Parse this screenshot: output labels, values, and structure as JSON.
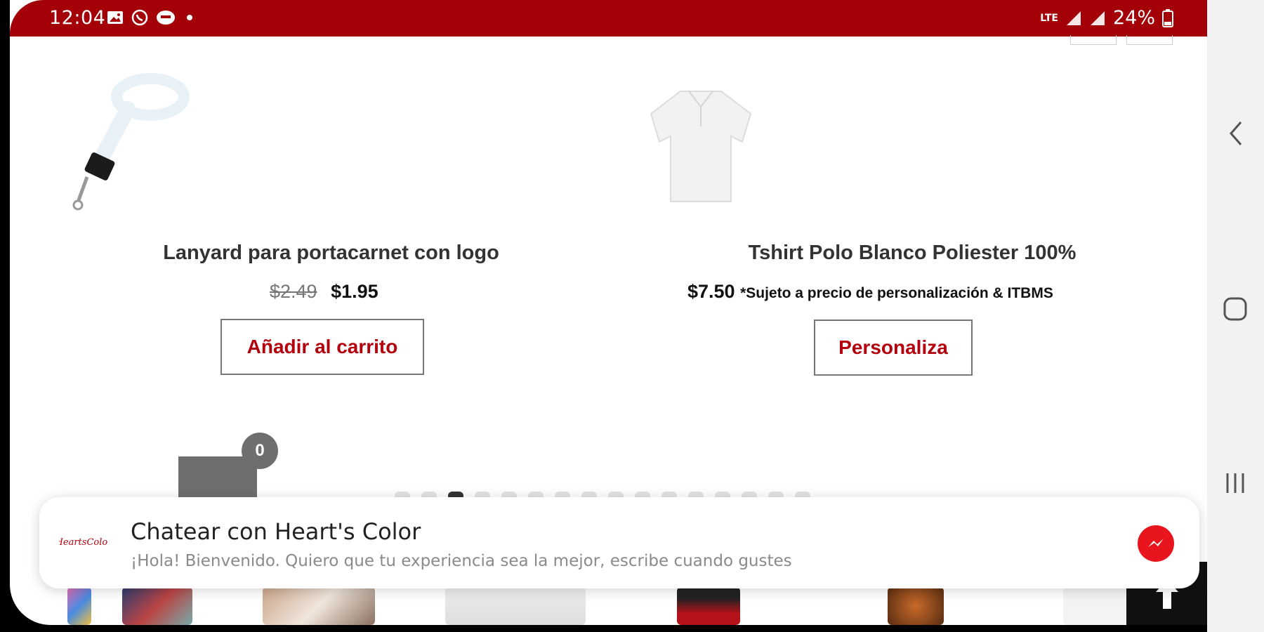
{
  "status_bar": {
    "time": "12:04",
    "battery": "24%",
    "network": "LTE",
    "icons": [
      "gallery-icon",
      "whatsapp-icon",
      "messaging-icon",
      "dot-icon",
      "signal-icon",
      "signal-icon",
      "battery-icon"
    ],
    "bg_color": "#a30008"
  },
  "products": [
    {
      "title": "Lanyard para portacarnet con logo",
      "old_price": "$2.49",
      "price": "$1.95",
      "note": "",
      "button": "Añadir al carrito"
    },
    {
      "title": "Tshirt Polo Blanco Poliester 100%",
      "old_price": "",
      "price": "$7.50",
      "note": "*Sujeto a precio de personalización & ITBMS",
      "button": "Personaliza"
    }
  ],
  "cart": {
    "count": "0"
  },
  "carousel": {
    "dot_count": 16,
    "active_index": 2
  },
  "chat": {
    "title": "Chatear con Heart's Color",
    "subtitle": "¡Hola! Bienvenido. Quiero que tu experiencia sea la mejor, escribe cuando gustes",
    "logo_text": "HeartsColor",
    "accent": "#e8141e"
  },
  "accent_color": "#b3000c",
  "nav_bar": {
    "icons": [
      "back-icon",
      "home-icon",
      "recent-apps-icon"
    ]
  }
}
